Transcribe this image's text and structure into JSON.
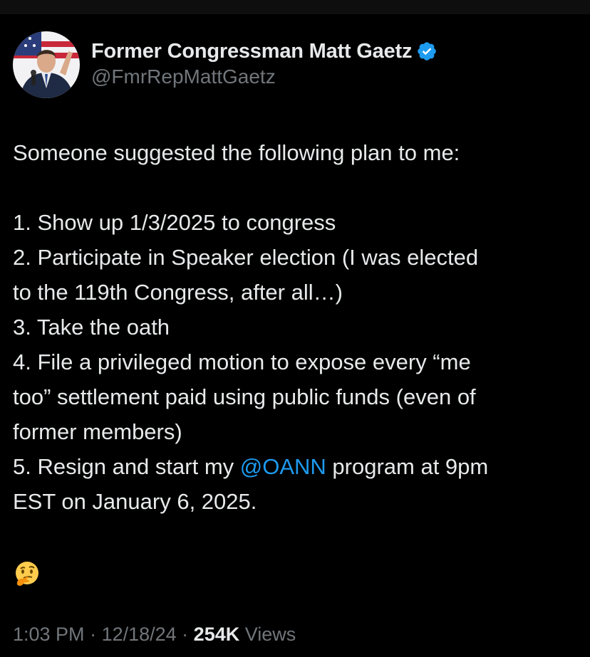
{
  "author": {
    "display_name": "Former Congressman Matt Gaetz",
    "handle": "@FmrRepMattGaetz",
    "verified": true,
    "avatar_icon": "profile-photo-icon"
  },
  "tweet": {
    "intro": "Someone suggested the following plan to me:",
    "item1": "1. Show up 1/3/2025 to congress",
    "item2_line1": "2. Participate in Speaker election (I was elected",
    "item2_line2": "to the 119th Congress, after all…)",
    "item3": "3. Take the oath",
    "item4_line1": "4. File a privileged motion to expose every “me",
    "item4_line2": "too” settlement paid using public funds (even of",
    "item4_line3": "former members)",
    "item5_pre": "5. Resign and start my ",
    "item5_mention": "@OANN",
    "item5_post": " program at 9pm",
    "item5_line2": "EST on January 6, 2025.",
    "emoji": "thinking-face-icon"
  },
  "meta": {
    "time": "1:03 PM",
    "separator": " · ",
    "date": "12/18/24",
    "views_count": "254K",
    "views_label": " Views"
  },
  "colors": {
    "background": "#000000",
    "text": "#e7e9ea",
    "secondary": "#71767b",
    "link": "#1d9bf0"
  }
}
